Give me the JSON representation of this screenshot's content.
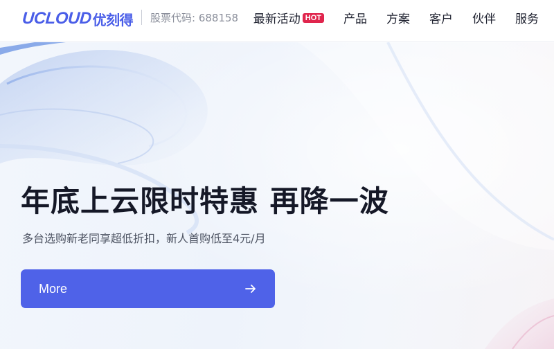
{
  "header": {
    "logo_latin": "UCLOUD",
    "logo_cn": "优刻得",
    "stock_code": "股票代码: 688158",
    "nav": [
      {
        "label": "最新活动",
        "badge": "HOT"
      },
      {
        "label": "产品"
      },
      {
        "label": "方案"
      },
      {
        "label": "客户"
      },
      {
        "label": "伙伴"
      },
      {
        "label": "服务"
      }
    ]
  },
  "hero": {
    "headline": "年底上云限时特惠 再降一波",
    "subline": "多台选购新老同享超低折扣，新人首购低至4元/月",
    "button_label": "More",
    "button_icon": "arrow-right-icon"
  },
  "colors": {
    "brand": "#4a5ee8",
    "button": "#4f62e8",
    "hot_badge": "#e0254d"
  }
}
